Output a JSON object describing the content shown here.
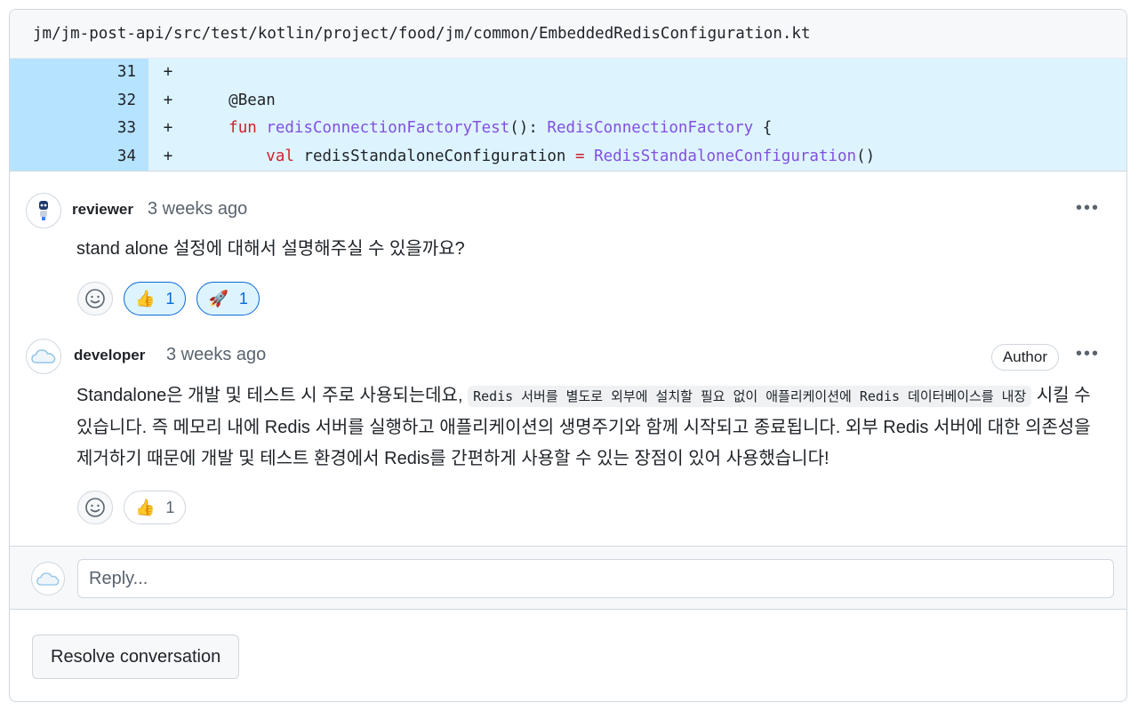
{
  "file": {
    "path": "jm/jm-post-api/src/test/kotlin/project/food/jm/common/EmbeddedRedisConfiguration.kt"
  },
  "diff": {
    "lines": [
      {
        "num": "31",
        "sign": "+",
        "indent": "",
        "parts": []
      },
      {
        "num": "32",
        "sign": "+",
        "indent": "    ",
        "parts": [
          [
            "pl",
            "@Bean"
          ]
        ]
      },
      {
        "num": "33",
        "sign": "+",
        "indent": "    ",
        "parts": [
          [
            "kw",
            "fun"
          ],
          [
            "pl",
            " "
          ],
          [
            "fn",
            "redisConnectionFactoryTest"
          ],
          [
            "pl",
            "(): "
          ],
          [
            "ty",
            "RedisConnectionFactory"
          ],
          [
            "pl",
            " {"
          ]
        ]
      },
      {
        "num": "34",
        "sign": "+",
        "indent": "        ",
        "parts": [
          [
            "kw",
            "val"
          ],
          [
            "pl",
            " redisStandaloneConfiguration "
          ],
          [
            "op",
            "="
          ],
          [
            "pl",
            " "
          ],
          [
            "ty",
            "RedisStandaloneConfiguration"
          ],
          [
            "pl",
            "()"
          ]
        ]
      }
    ]
  },
  "comments": [
    {
      "author": "reviewer",
      "time": "3 weeks ago",
      "body": "stand alone 설정에 대해서 설명해주실 수 있을까요?",
      "reactions": [
        {
          "emoji": "👍",
          "count": "1",
          "active": true
        },
        {
          "emoji": "🚀",
          "count": "1",
          "active": true
        }
      ]
    },
    {
      "author": "developer",
      "time": "3 weeks ago",
      "badge": "Author",
      "body_pre": "Standalone은 개발 및 테스트 시 주로 사용되는데요, ",
      "body_code": "Redis 서버를 별도로 외부에 설치할 필요 없이 애플리케이션에 Redis 데이터베이스를 내장",
      "body_post": " 시킬 수 있습니다. 즉 메모리 내에 Redis 서버를 실행하고 애플리케이션의 생명주기와 함께 시작되고 종료됩니다. 외부 Redis 서버에 대한 의존성을 제거하기 때문에 개발 및 테스트 환경에서 Redis를 간편하게 사용할 수 있는 장점이 있어 사용했습니다!",
      "reactions": [
        {
          "emoji": "👍",
          "count": "1",
          "active": false
        }
      ]
    }
  ],
  "reply": {
    "placeholder": "Reply..."
  },
  "resolve_label": "Resolve conversation",
  "colors": {
    "accent": "#0969da",
    "diff_bg": "#ddf4ff",
    "diff_num_bg": "#b6e3ff",
    "keyword": "#cf222e",
    "type": "#8250df"
  },
  "icons": {
    "more": "kebab-horizontal-icon",
    "add_reaction": "smiley-icon"
  }
}
